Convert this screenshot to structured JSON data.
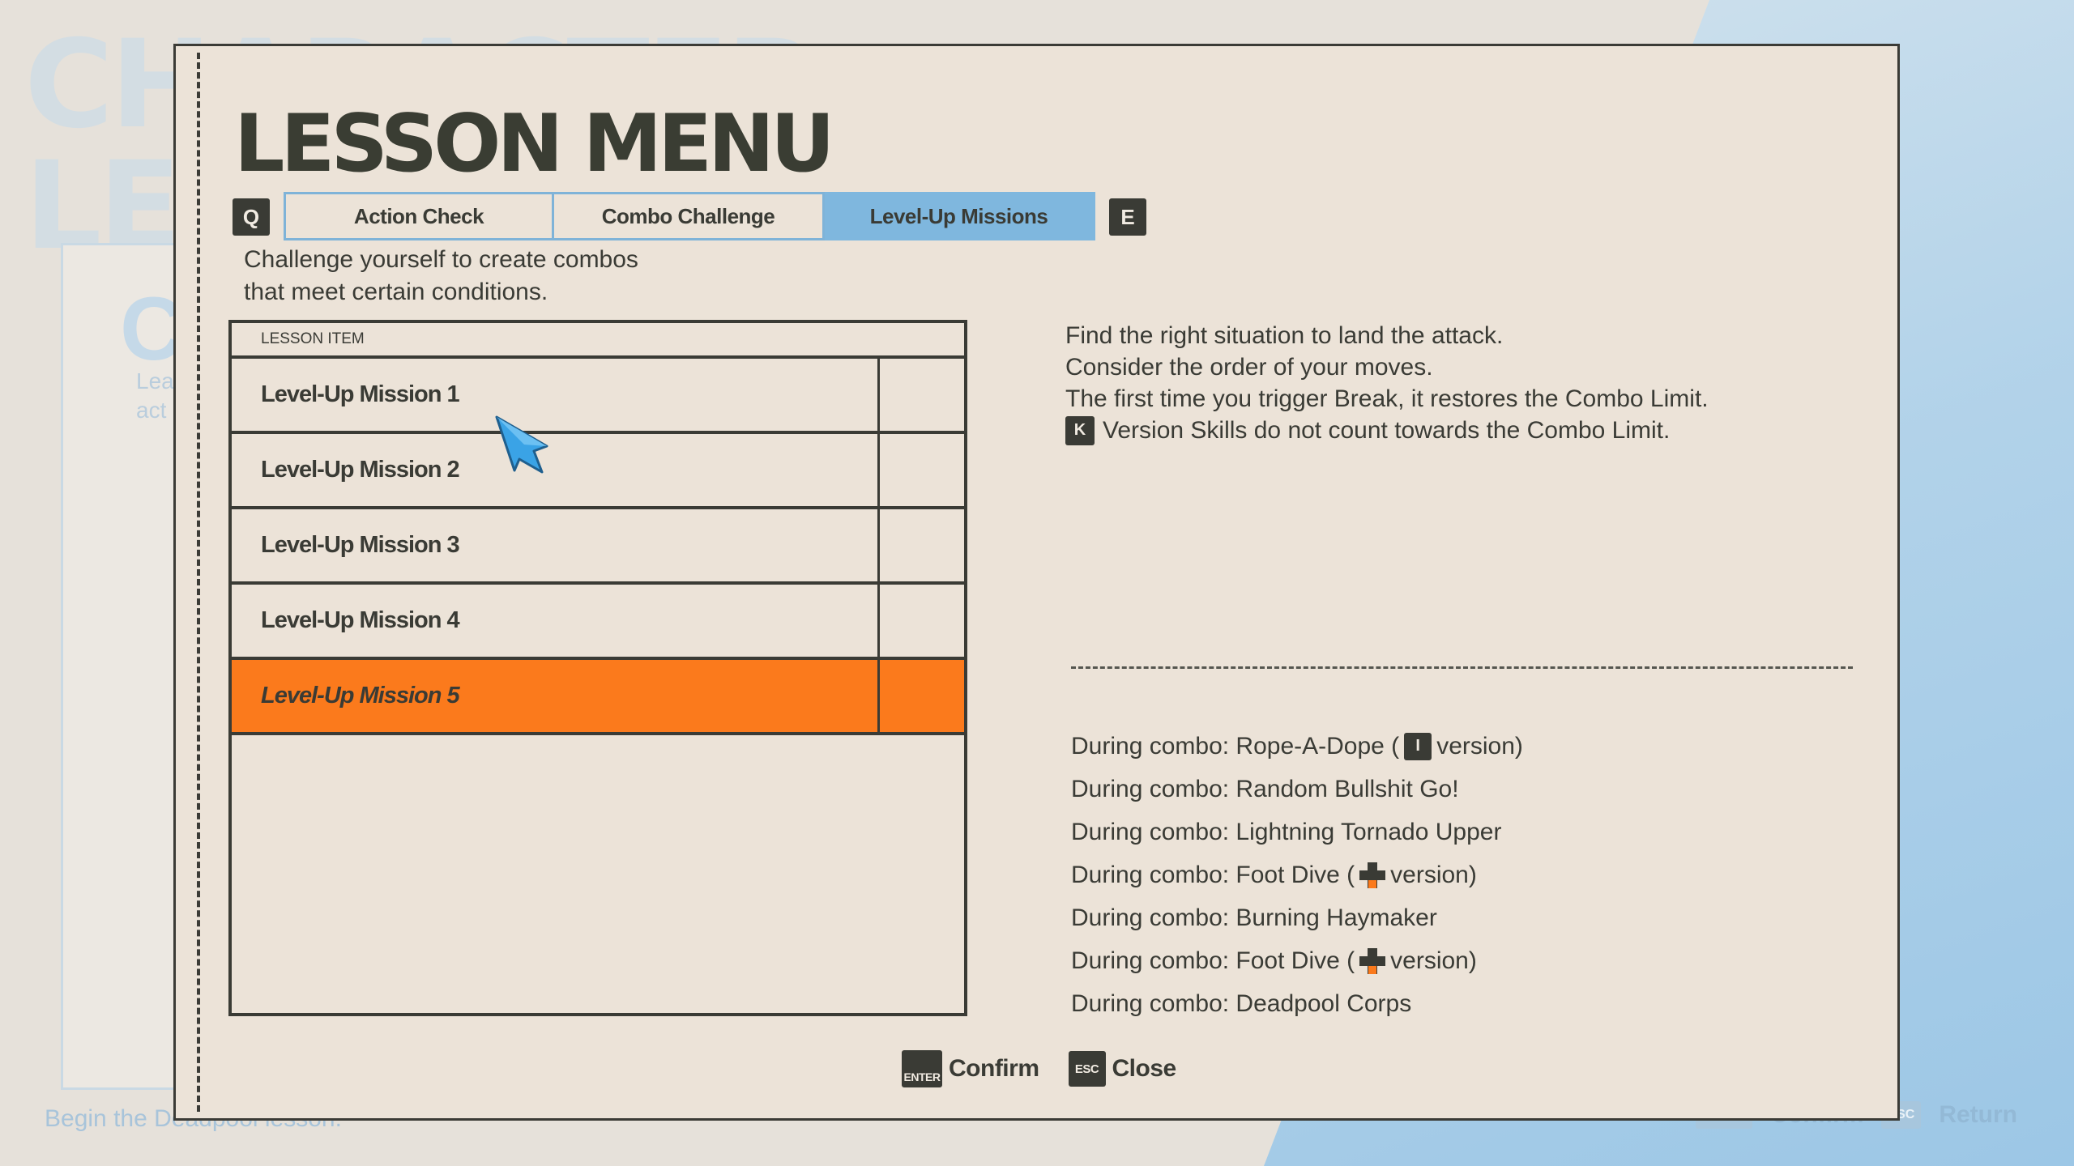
{
  "background": {
    "title_line1": "CHARACTER",
    "title_line2": "LESSON",
    "sheet_letter": "C",
    "sheet_text_line1": "Lea",
    "sheet_text_line2": "act",
    "bottom_text": "Begin the Deadpool lesson.",
    "footer": {
      "confirm_key": "ENTER",
      "confirm_label": "Confirm",
      "return_key": "ESC",
      "return_label": "Return"
    }
  },
  "menu": {
    "title": "LESSON MENU",
    "prev_tab_key": "Q",
    "next_tab_key": "E",
    "tabs": [
      {
        "label": "Action Check"
      },
      {
        "label": "Combo Challenge"
      },
      {
        "label": "Level-Up Missions"
      }
    ],
    "active_tab": 2,
    "subtitle_line1": "Challenge yourself to create combos",
    "subtitle_line2": "that meet certain conditions."
  },
  "list": {
    "header": "LESSON ITEM",
    "items": [
      {
        "label": "Level-Up Mission 1"
      },
      {
        "label": "Level-Up Mission 2"
      },
      {
        "label": "Level-Up Mission 3"
      },
      {
        "label": "Level-Up Mission 4"
      },
      {
        "label": "Level-Up Mission 5"
      }
    ],
    "selected_index": 4
  },
  "details": {
    "line1": "Find the right situation to land the attack.",
    "line2": "Consider the order of your moves.",
    "line3": "The first time you trigger Break, it restores the Combo Limit.",
    "line4_key": "K",
    "line4_text": "Version Skills do not count towards the Combo Limit.",
    "conditions": {
      "c1_pre": "During combo: Rope-A-Dope (",
      "c1_key": "I",
      "c1_post": "version)",
      "c2": "During combo: Random Bullshit Go!",
      "c3": "During combo: Lightning Tornado Upper",
      "c4_pre": "During combo: Foot Dive (",
      "c4_post": "version)",
      "c5": "During combo: Burning Haymaker",
      "c6_pre": "During combo: Foot Dive (",
      "c6_post": "version)",
      "c7": "During combo: Deadpool Corps"
    }
  },
  "footer": {
    "confirm_key": "ENTER",
    "confirm_label": "Confirm",
    "close_key": "ESC",
    "close_label": "Close"
  },
  "colors": {
    "panel_bg": "#ece3d8",
    "ink": "#3a3b35",
    "accent_blue": "#7fb7de",
    "selection_orange": "#fb7a1c",
    "cursor_blue": "#3aa3e6"
  }
}
